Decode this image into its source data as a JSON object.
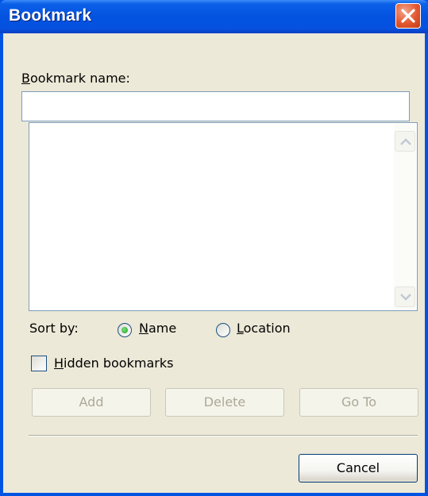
{
  "window": {
    "title": "Bookmark",
    "close_icon": "close-icon"
  },
  "bookmark_name": {
    "label": "Bookmark name:",
    "value": ""
  },
  "bookmark_list": {
    "items": [],
    "scroll_up_icon": "chevron-up-icon",
    "scroll_down_icon": "chevron-down-icon"
  },
  "sort_by": {
    "label": "Sort by:",
    "options": [
      {
        "label": "Name",
        "selected": true
      },
      {
        "label": "Location",
        "selected": false
      }
    ]
  },
  "hidden_bookmarks": {
    "label": "Hidden bookmarks",
    "checked": false
  },
  "buttons": {
    "add": "Add",
    "delete": "Delete",
    "go_to": "Go To",
    "cancel": "Cancel"
  },
  "colors": {
    "title_bar": "#0054e3",
    "dialog_face": "#ece9d8",
    "close_button": "#e3572f",
    "radio_selected": "#21a121"
  }
}
